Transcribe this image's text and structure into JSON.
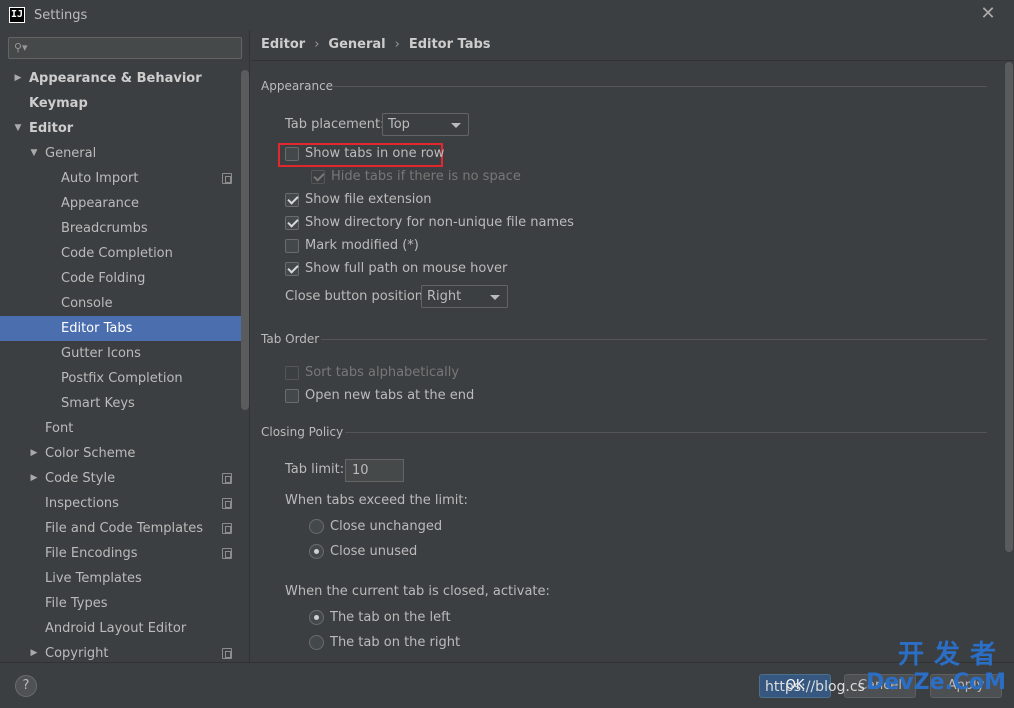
{
  "window": {
    "title": "Settings",
    "app_icon": "IJ"
  },
  "search": {
    "placeholder": ""
  },
  "sidebar": {
    "items": [
      {
        "label": "Appearance & Behavior"
      },
      {
        "label": "Keymap"
      },
      {
        "label": "Editor"
      },
      {
        "label": "General"
      },
      {
        "label": "Auto Import"
      },
      {
        "label": "Appearance"
      },
      {
        "label": "Breadcrumbs"
      },
      {
        "label": "Code Completion"
      },
      {
        "label": "Code Folding"
      },
      {
        "label": "Console"
      },
      {
        "label": "Editor Tabs"
      },
      {
        "label": "Gutter Icons"
      },
      {
        "label": "Postfix Completion"
      },
      {
        "label": "Smart Keys"
      },
      {
        "label": "Font"
      },
      {
        "label": "Color Scheme"
      },
      {
        "label": "Code Style"
      },
      {
        "label": "Inspections"
      },
      {
        "label": "File and Code Templates"
      },
      {
        "label": "File Encodings"
      },
      {
        "label": "Live Templates"
      },
      {
        "label": "File Types"
      },
      {
        "label": "Android Layout Editor"
      },
      {
        "label": "Copyright"
      }
    ]
  },
  "breadcrumb": {
    "a": "Editor",
    "b": "General",
    "c": "Editor Tabs",
    "sep": "›"
  },
  "appearance": {
    "section": "Appearance",
    "tab_placement_label": "Tab placement:",
    "tab_placement_value": "Top",
    "show_one_row": "Show tabs in one row",
    "hide_no_space": "Hide tabs if there is no space",
    "show_ext": "Show file extension",
    "show_dir": "Show directory for non-unique file names",
    "mark_modified": "Mark modified (*)",
    "full_path": "Show full path on mouse hover",
    "close_pos_label": "Close button position:",
    "close_pos_value": "Right"
  },
  "tab_order": {
    "section": "Tab Order",
    "sort_alpha": "Sort tabs alphabetically",
    "open_end": "Open new tabs at the end"
  },
  "closing": {
    "section": "Closing Policy",
    "tab_limit_label": "Tab limit:",
    "tab_limit_value": "10",
    "exceed_label": "When tabs exceed the limit:",
    "close_unchanged": "Close unchanged",
    "close_unused": "Close unused",
    "current_closed_label": "When the current tab is closed, activate:",
    "tab_left": "The tab on the left",
    "tab_right": "The tab on the right"
  },
  "buttons": {
    "help": "?",
    "ok": "OK",
    "cancel": "Cancel",
    "apply": "Apply"
  },
  "watermark": {
    "url": "https://blog.cs",
    "brand_top": "开发者",
    "brand_bottom": "DevZe.CoM"
  },
  "colors": {
    "accent": "#4b6eaf",
    "highlight_border": "#e0282e",
    "background": "#3c3f41"
  }
}
